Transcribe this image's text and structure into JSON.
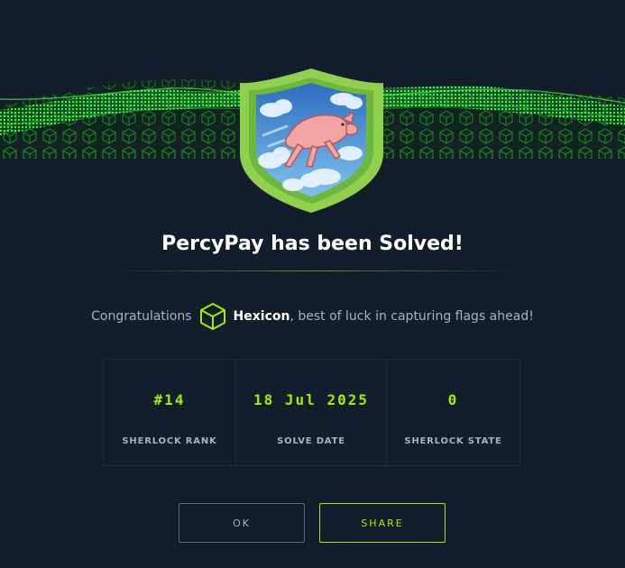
{
  "dialog": {
    "title": "PercyPay has been Solved!",
    "congrats_prefix": "Congratulations",
    "username": "Hexicon",
    "congrats_suffix": ", best of luck in capturing flags ahead!",
    "badge_icon": "flying-pig-shield",
    "user_icon": "cube-icon"
  },
  "stats": [
    {
      "value": "#14",
      "label": "SHERLOCK RANK"
    },
    {
      "value": "18 Jul 2025",
      "label": "SOLVE DATE"
    },
    {
      "value": "0",
      "label": "SHERLOCK STATE"
    }
  ],
  "buttons": {
    "ok": "OK",
    "share": "SHARE"
  },
  "colors": {
    "background": "#141d2b",
    "accent": "#9fef00",
    "muted": "#a4b1cd",
    "border": "#1f2b3d"
  }
}
